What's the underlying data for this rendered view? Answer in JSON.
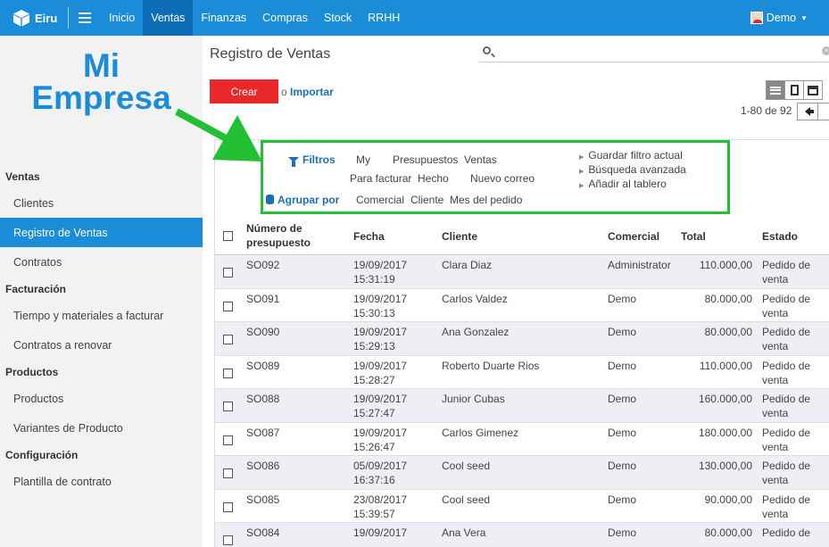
{
  "topbar": {
    "brand": "Eiru",
    "menu": [
      "Inicio",
      "Ventas",
      "Finanzas",
      "Compras",
      "Stock",
      "RRHH"
    ],
    "active_menu": "Ventas",
    "user": "Demo"
  },
  "sidebar": {
    "brand_line1": "Mi",
    "brand_line2": "Empresa",
    "sections": [
      {
        "title": "Ventas",
        "items": [
          "Clientes",
          "Registro de Ventas",
          "Contratos"
        ]
      },
      {
        "title": "Facturación",
        "items": [
          "Tiempo y materiales a facturar",
          "Contratos a renovar"
        ]
      },
      {
        "title": "Productos",
        "items": [
          "Productos",
          "Variantes de Producto"
        ]
      },
      {
        "title": "Configuración",
        "items": [
          "Plantilla de contrato"
        ]
      }
    ],
    "active_item": "Registro de Ventas"
  },
  "main": {
    "title": "Registro de Ventas",
    "search_value": "",
    "create_label": "Crear",
    "or_label": "o",
    "import_label": "Importar",
    "pager": "1-80 de 92"
  },
  "filters": {
    "filters_label": "Filtros",
    "group_label": "Agrupar por",
    "filter_items": [
      "My",
      "Presupuestos",
      "Ventas",
      "Para facturar",
      "Hecho",
      "Nuevo correo"
    ],
    "group_items": [
      "Comercial",
      "Cliente",
      "Mes del pedido"
    ],
    "favorites": [
      "Guardar filtro actual",
      "Búsqueda avanzada",
      "Añadir al tablero"
    ]
  },
  "table": {
    "headers": {
      "number": "Número de presupuesto",
      "date": "Fecha",
      "client": "Cliente",
      "salesperson": "Comercial",
      "total": "Total",
      "state": "Estado"
    },
    "rows": [
      {
        "number": "SO092",
        "date": "19/09/2017",
        "time": "15:31:19",
        "client": "Clara Diaz",
        "salesperson": "Administrator",
        "total": "110.000,00",
        "state1": "Pedido de",
        "state2": "venta"
      },
      {
        "number": "SO091",
        "date": "19/09/2017",
        "time": "15:30:13",
        "client": "Carlos Valdez",
        "salesperson": "Demo",
        "total": "80.000,00",
        "state1": "Pedido de",
        "state2": "venta"
      },
      {
        "number": "SO090",
        "date": "19/09/2017",
        "time": "15:29:13",
        "client": "Ana Gonzalez",
        "salesperson": "Demo",
        "total": "80.000,00",
        "state1": "Pedido de",
        "state2": "venta"
      },
      {
        "number": "SO089",
        "date": "19/09/2017",
        "time": "15:28:27",
        "client": "Roberto Duarte Rios",
        "salesperson": "Demo",
        "total": "110.000,00",
        "state1": "Pedido de",
        "state2": "venta"
      },
      {
        "number": "SO088",
        "date": "19/09/2017",
        "time": "15:27:47",
        "client": "Junior Cubas",
        "salesperson": "Demo",
        "total": "160.000,00",
        "state1": "Pedido de",
        "state2": "venta"
      },
      {
        "number": "SO087",
        "date": "19/09/2017",
        "time": "15:26:47",
        "client": "Carlos Gimenez",
        "salesperson": "Demo",
        "total": "180.000,00",
        "state1": "Pedido de",
        "state2": "venta"
      },
      {
        "number": "SO086",
        "date": "05/09/2017",
        "time": "16:37:16",
        "client": "Cool seed",
        "salesperson": "Demo",
        "total": "130.000,00",
        "state1": "Pedido de",
        "state2": "venta"
      },
      {
        "number": "SO085",
        "date": "23/08/2017",
        "time": "15:39:57",
        "client": "Cool seed",
        "salesperson": "Demo",
        "total": "90.000,00",
        "state1": "Pedido de",
        "state2": "venta"
      },
      {
        "number": "SO084",
        "date": "19/09/2017",
        "time": "",
        "client": "Ana Vera",
        "salesperson": "Demo",
        "total": "80.000,00",
        "state1": "Pedido de",
        "state2": ""
      }
    ]
  },
  "colors": {
    "primary": "#1a8cd8",
    "create_button": "#e8282a",
    "annotation_green": "#22c032",
    "row_stripe": "#eeeef5"
  }
}
